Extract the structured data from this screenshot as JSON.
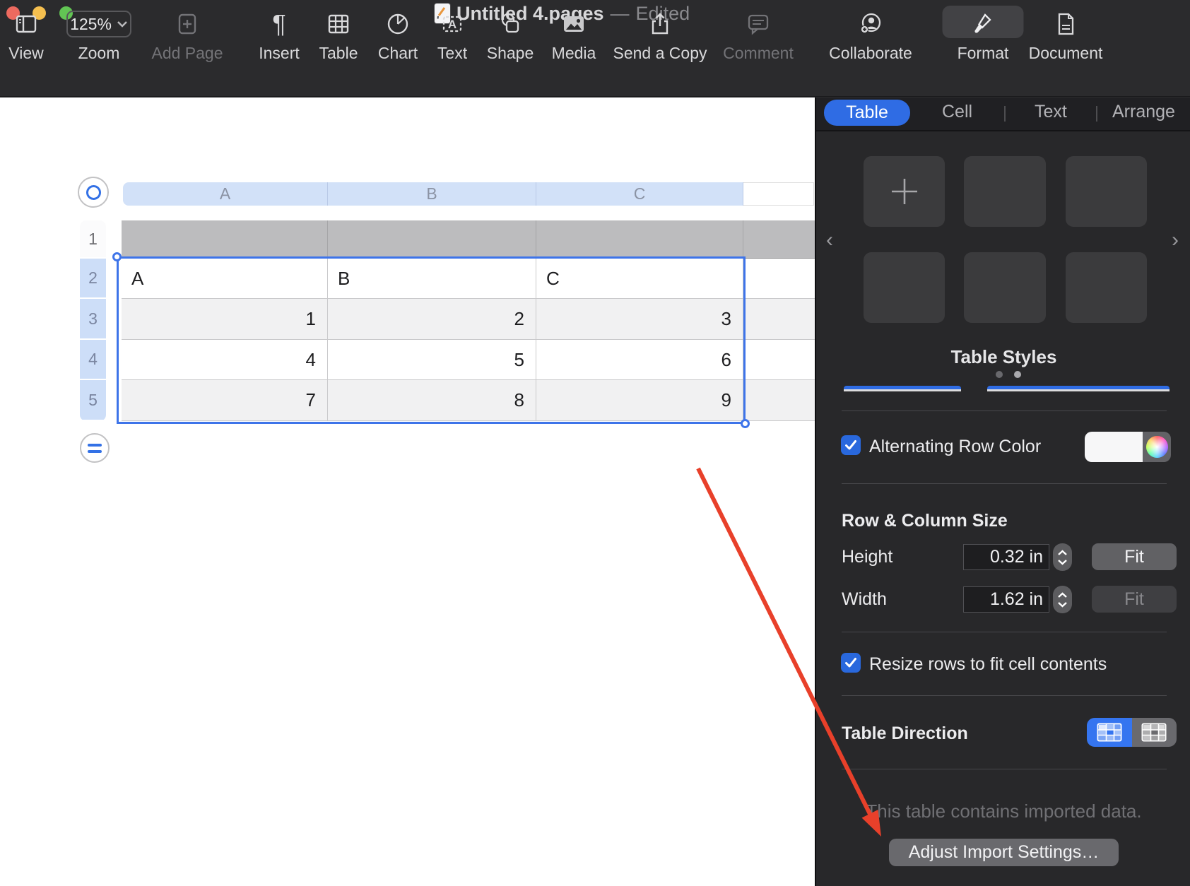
{
  "window": {
    "title": "Untitled 4.pages",
    "separator": "—",
    "edited_badge": "Edited"
  },
  "toolbar": {
    "zoom_value": "125%",
    "items": [
      {
        "label": "View",
        "enabled": true
      },
      {
        "label": "Zoom",
        "enabled": true
      },
      {
        "label": "Add Page",
        "enabled": false
      },
      {
        "label": "Insert",
        "enabled": true
      },
      {
        "label": "Table",
        "enabled": true
      },
      {
        "label": "Chart",
        "enabled": true
      },
      {
        "label": "Text",
        "enabled": true
      },
      {
        "label": "Shape",
        "enabled": true
      },
      {
        "label": "Media",
        "enabled": true
      },
      {
        "label": "Send a Copy",
        "enabled": true
      },
      {
        "label": "Comment",
        "enabled": false
      },
      {
        "label": "Collaborate",
        "enabled": true
      },
      {
        "label": "Format",
        "enabled": true,
        "active": true
      },
      {
        "label": "Document",
        "enabled": true
      }
    ]
  },
  "document": {
    "table": {
      "column_headers": [
        "A",
        "B",
        "C"
      ],
      "row_numbers": [
        "1",
        "2",
        "3",
        "4",
        "5"
      ],
      "rows": [
        [
          "A",
          "B",
          "C"
        ],
        [
          "1",
          "2",
          "3"
        ],
        [
          "4",
          "5",
          "6"
        ],
        [
          "7",
          "8",
          "9"
        ]
      ]
    }
  },
  "sidebar": {
    "tabs": [
      "Table",
      "Cell",
      "Text",
      "Arrange"
    ],
    "active_tab": "Table",
    "styles_caption": "Table Styles",
    "styles_page": 2,
    "alternating_label": "Alternating Row Color",
    "alternating_checked": true,
    "size_section": {
      "title": "Row & Column Size",
      "height_label": "Height",
      "height_value": "0.32 in",
      "width_label": "Width",
      "width_value": "1.62 in",
      "height_fit_label": "Fit",
      "width_fit_label": "Fit"
    },
    "resize_label": "Resize rows to fit cell contents",
    "resize_checked": true,
    "direction_label": "Table Direction",
    "imported_note": "This table contains imported data.",
    "adjust_button_label": "Adjust Import Settings…"
  },
  "colors": {
    "accent_blue": "#2f6ce4",
    "selection_blue": "#3e74e9",
    "annotation_arrow_red": "#e8402a",
    "traffic_red": "#ed6a5f",
    "traffic_yellow": "#f5bf4f",
    "traffic_green": "#62c554",
    "header_row_gray": "#bcbcbe",
    "alt_row_gray": "#f1f1f2",
    "column_header_blue": "#d2e1f8"
  }
}
